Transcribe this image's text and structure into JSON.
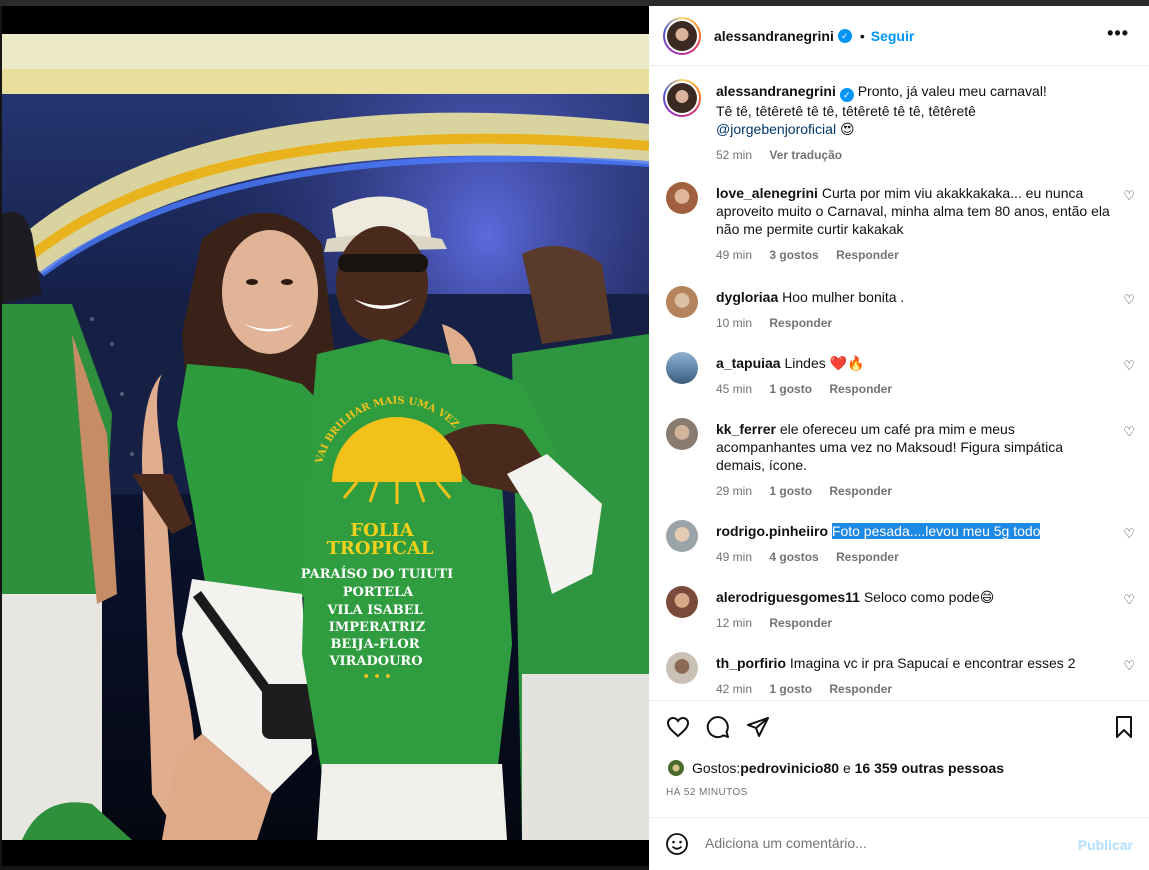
{
  "header": {
    "username": "alessandranegrini",
    "separator": "•",
    "follow_label": "Seguir",
    "more_label": "•••"
  },
  "caption": {
    "username": "alessandranegrini",
    "line1": "Pronto, já valeu meu carnaval!",
    "line2": "Tê tê, têtêretê tê tê, têtêretê tê tê, têtêretê",
    "mention": "@jorgebenjoroficial",
    "emoji": "😍",
    "time": "52 min",
    "translate": "Ver tradução"
  },
  "comments": [
    {
      "username": "love_alenegrini",
      "text": "Curta por mim viu akakkakaka... eu nunca aproveito muito o Carnaval, minha alma tem 80 anos, então ela não me permite curtir kakakak",
      "time": "49 min",
      "likes": "3 gostos",
      "reply": "Responder",
      "avatar_color": "#a1603f"
    },
    {
      "username": "dygloriaa",
      "text": "Hoo mulher bonita .",
      "time": "10 min",
      "likes": "",
      "reply": "Responder",
      "avatar_color": "#b5845c"
    },
    {
      "username": "a_tapuiaa",
      "text": "Lindes ❤️🔥",
      "time": "45 min",
      "likes": "1 gosto",
      "reply": "Responder",
      "avatar_color": "#5c7fa6"
    },
    {
      "username": "kk_ferrer",
      "text": "ele ofereceu um café pra mim e meus acompanhantes uma vez no Maksoud! Figura simpática demais, ícone.",
      "time": "29 min",
      "likes": "1 gosto",
      "reply": "Responder",
      "avatar_color": "#8a7b70"
    },
    {
      "username": "rodrigo.pinheiiro",
      "text": "Foto pesada....levou meu 5g todo",
      "time": "49 min",
      "likes": "4 gostos",
      "reply": "Responder",
      "avatar_color": "#9aa3a8"
    },
    {
      "username": "alerodriguesgomes11",
      "text": "Seloco como pode😄",
      "time": "12 min",
      "likes": "",
      "reply": "Responder",
      "avatar_color": "#7a4b3a"
    },
    {
      "username": "th_porfirio",
      "text": "Imagina vc ir pra Sapucaí e encontrar esses 2",
      "time": "42 min",
      "likes": "1 gosto",
      "reply": "Responder",
      "avatar_color": "#c9c2b4"
    }
  ],
  "likes": {
    "prefix": "Gostos: ",
    "user": "pedrovinicio80",
    "middle": " e ",
    "others": "16 359 outras pessoas"
  },
  "time_ago": "HÁ 52 MINUTOS",
  "add_comment": {
    "placeholder": "Adiciona um comentário...",
    "publish": "Publicar"
  },
  "shirt": {
    "arc_text": "VAI BRILHAR MAIS UMA VEZ",
    "line1": "FOLIA",
    "line2": "TROPICAL",
    "line3": "PARAÍSO DO TUIUTI",
    "line4": "PORTELA",
    "line5": "VILA ISABEL",
    "line6": "IMPERATRIZ",
    "line7": "BEIJA-FLOR",
    "line8": "VIRADOURO",
    "dots": "• • •"
  },
  "colors": {
    "accent": "#0095f6",
    "shirt_green": "#2e9b3e",
    "sun_yellow": "#f2c21b"
  }
}
